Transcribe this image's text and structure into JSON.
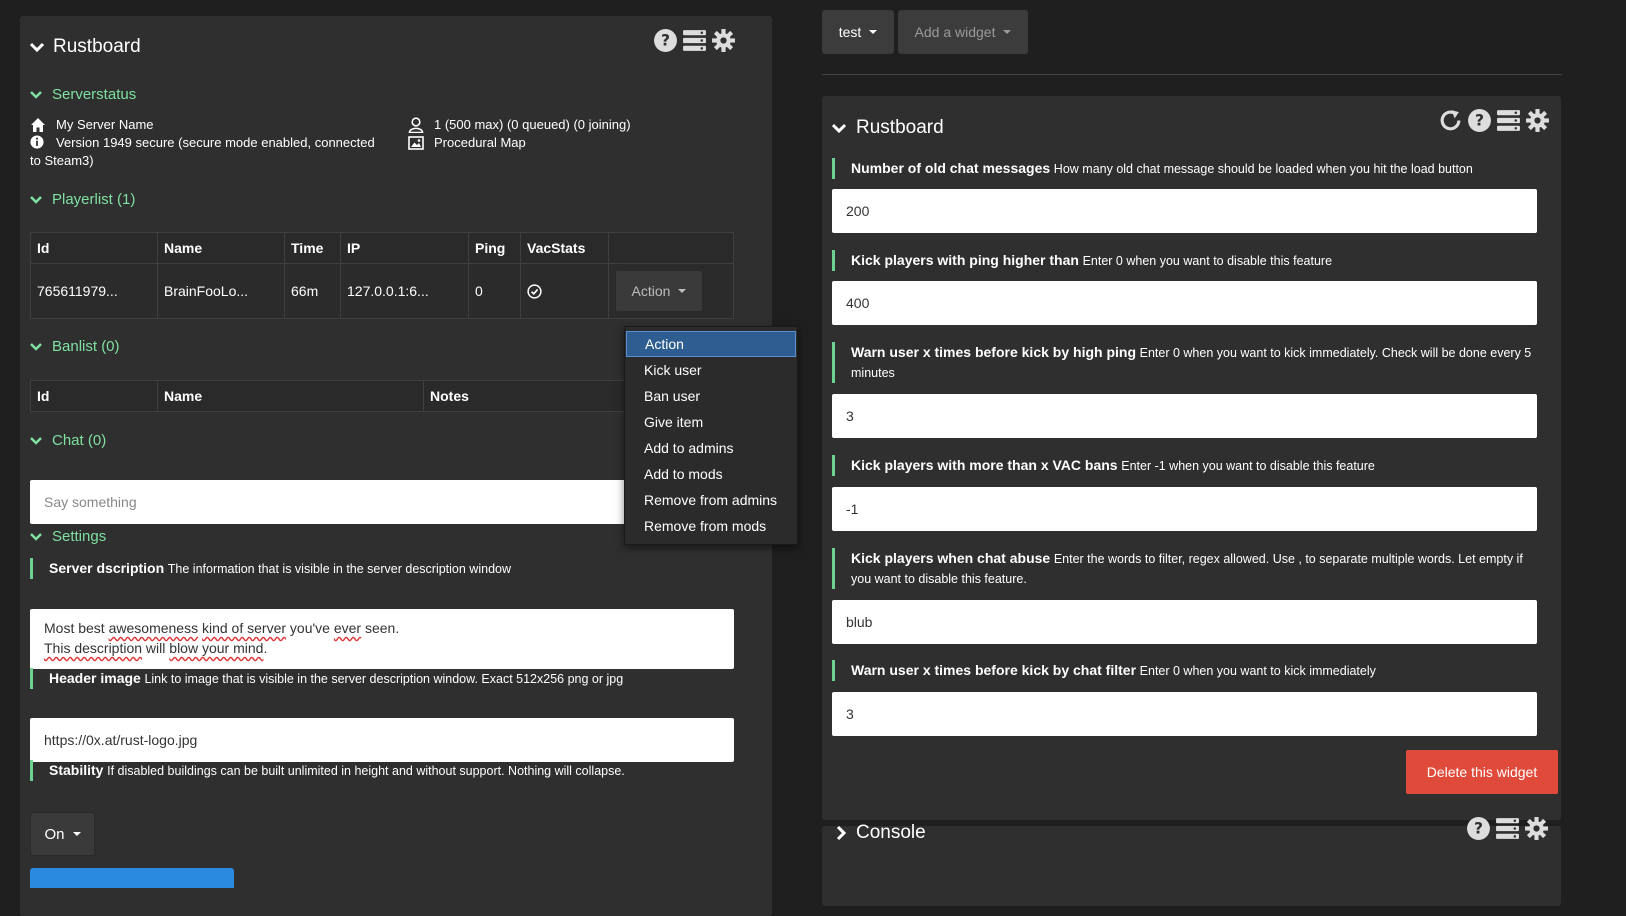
{
  "left": {
    "title": "Rustboard",
    "serverstatus": {
      "heading": "Serverstatus",
      "server_name": "My Server Name",
      "version": "Version 1949 secure (secure mode enabled, connected",
      "version_cont": "to Steam3)",
      "players": "1 (500 max) (0 queued) (0 joining)",
      "map": "Procedural Map"
    },
    "playerlist": {
      "heading": "Playerlist (1)",
      "columns": [
        "Id",
        "Name",
        "Time",
        "IP",
        "Ping",
        "VacStats"
      ],
      "rows": [
        {
          "id": "765611979...",
          "name": "BrainFooLo...",
          "time": "66m",
          "ip": "127.0.0.1:6...",
          "ping": "0",
          "action": "Action"
        }
      ]
    },
    "banlist": {
      "heading": "Banlist (0)",
      "columns": [
        "Id",
        "Name",
        "Notes"
      ]
    },
    "chat": {
      "heading": "Chat (0)",
      "placeholder": "Say something"
    },
    "settings": {
      "heading": "Settings",
      "server_description": {
        "label": "Server dscription",
        "desc": "The information that is visible in the server description window",
        "value_line1": "Most best awesomeness kind of server you've ever seen.",
        "value_line2": "This description will blow your mind."
      },
      "header_image": {
        "label": "Header image",
        "desc": "Link to image that is visible in the server description window. Exact 512x256 png or jpg",
        "value": "https://0x.at/rust-logo.jpg"
      },
      "stability": {
        "label": "Stability",
        "desc": "If disabled buildings can be built unlimited in height and without support. Nothing will collapse.",
        "value": "On"
      }
    }
  },
  "action_menu": {
    "items": [
      "Action",
      "Kick user",
      "Ban user",
      "Give item",
      "Add to admins",
      "Add to mods",
      "Remove from admins",
      "Remove from mods"
    ],
    "selected": "Action"
  },
  "topbar": {
    "tab_label": "test",
    "add_widget_label": "Add a widget"
  },
  "right": {
    "title": "Rustboard",
    "settings": [
      {
        "label": "Number of old chat messages",
        "desc": "How many old chat message should be loaded when you hit the load button",
        "value": "200"
      },
      {
        "label": "Kick players with ping higher than",
        "desc": "Enter 0 when you want to disable this feature",
        "value": "400"
      },
      {
        "label": "Warn user x times before kick by high ping",
        "desc": "Enter 0 when you want to kick immediately. Check will be done every 5 minutes",
        "value": "3"
      },
      {
        "label": "Kick players with more than x VAC bans",
        "desc": "Enter -1 when you want to disable this feature",
        "value": "-1"
      },
      {
        "label": "Kick players when chat abuse",
        "desc": "Enter the words to filter, regex allowed. Use , to separate multiple words. Let empty if you want to disable this feature.",
        "value": "blub"
      },
      {
        "label": "Warn user x times before kick by chat filter",
        "desc": "Enter 0 when you want to kick immediately",
        "value": "3"
      }
    ],
    "delete_label": "Delete this widget"
  },
  "console": {
    "title": "Console"
  },
  "colors": {
    "accent_green": "#7fe0a1",
    "danger": "#e04a3a",
    "menu_active": "#2e5e91",
    "panel_bg": "#2f2f2f",
    "page_bg": "#1f1f1f"
  }
}
